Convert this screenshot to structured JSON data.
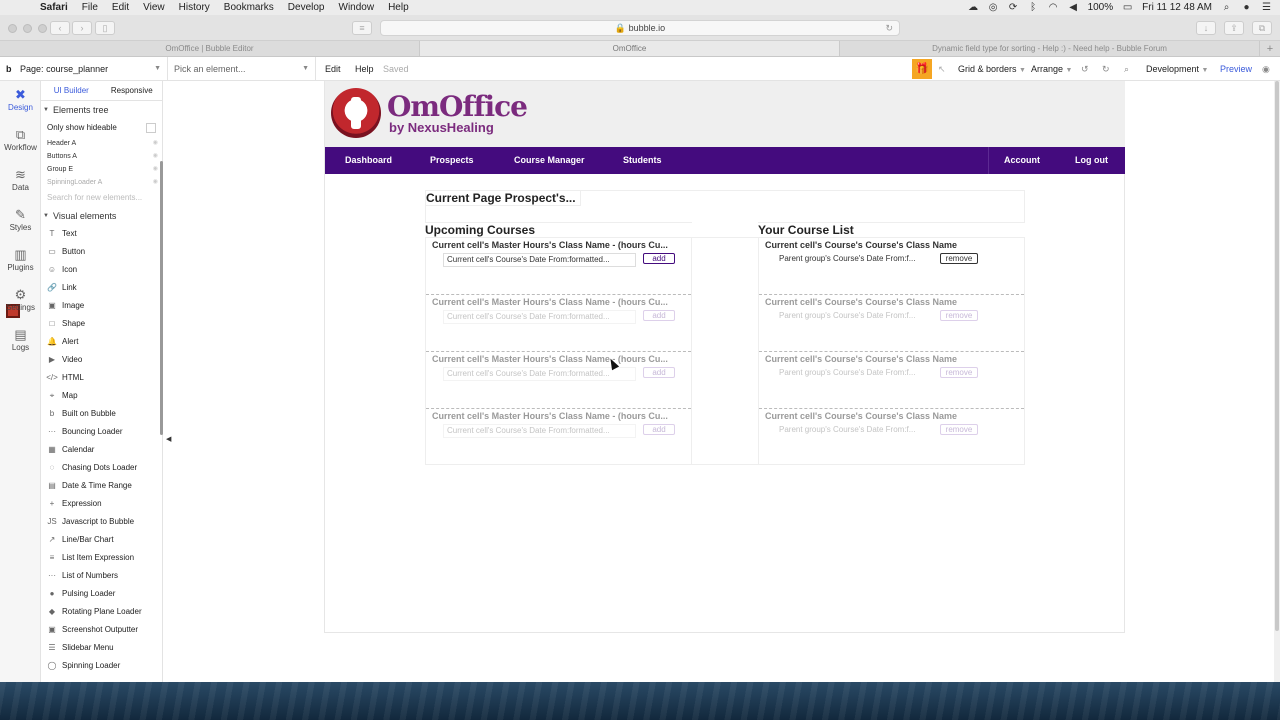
{
  "mac_menubar": {
    "app": "Safari",
    "items": [
      "File",
      "Edit",
      "View",
      "History",
      "Bookmarks",
      "Develop",
      "Window",
      "Help"
    ],
    "battery": "100%",
    "clock": "Fri 11 12 48 AM"
  },
  "browser": {
    "url": "bubble.io",
    "tabs": [
      "OmOffice | Bubble Editor",
      "OmOffice",
      "Dynamic field type for sorting - Help :) - Need help - Bubble Forum"
    ]
  },
  "editor_top": {
    "page_label": "Page:",
    "page_name": "course_planner",
    "element_picker": "Pick an element...",
    "edit": "Edit",
    "help": "Help",
    "saved": "Saved",
    "grid": "Grid & borders",
    "arrange": "Arrange",
    "environment": "Development",
    "preview": "Preview"
  },
  "rail": [
    "Design",
    "Workflow",
    "Data",
    "Styles",
    "Plugins",
    "Settings",
    "Logs"
  ],
  "palette": {
    "tabs": [
      "UI Builder",
      "Responsive"
    ],
    "elements_tree": "Elements tree",
    "only_hideable": "Only show hideable",
    "tree": [
      "Header A",
      "Buttons A",
      "Group E",
      "SpinningLoader A"
    ],
    "search": "Search for new elements...",
    "visual_elements": "Visual elements",
    "items": [
      {
        "icon": "T",
        "label": "Text"
      },
      {
        "icon": "▭",
        "label": "Button"
      },
      {
        "icon": "☺",
        "label": "Icon"
      },
      {
        "icon": "🔗",
        "label": "Link"
      },
      {
        "icon": "▣",
        "label": "Image"
      },
      {
        "icon": "□",
        "label": "Shape"
      },
      {
        "icon": "🔔",
        "label": "Alert"
      },
      {
        "icon": "▶",
        "label": "Video"
      },
      {
        "icon": "</>",
        "label": "HTML"
      },
      {
        "icon": "⌖",
        "label": "Map"
      },
      {
        "icon": "b",
        "label": "Built on Bubble"
      },
      {
        "icon": "···",
        "label": "Bouncing Loader"
      },
      {
        "icon": "▦",
        "label": "Calendar"
      },
      {
        "icon": "◌",
        "label": "Chasing Dots Loader"
      },
      {
        "icon": "▤",
        "label": "Date & Time Range"
      },
      {
        "icon": "+",
        "label": "Expression"
      },
      {
        "icon": "JS",
        "label": "Javascript to Bubble"
      },
      {
        "icon": "↗",
        "label": "Line/Bar Chart"
      },
      {
        "icon": "≡",
        "label": "List Item Expression"
      },
      {
        "icon": "···",
        "label": "List of Numbers"
      },
      {
        "icon": "●",
        "label": "Pulsing Loader"
      },
      {
        "icon": "◆",
        "label": "Rotating Plane Loader"
      },
      {
        "icon": "▣",
        "label": "Screenshot Outputter"
      },
      {
        "icon": "☰",
        "label": "Slidebar Menu"
      },
      {
        "icon": "◯",
        "label": "Spinning Loader"
      }
    ]
  },
  "app": {
    "logo_title": "OmOffice",
    "logo_sub": "by NexusHealing",
    "nav": [
      "Dashboard",
      "Prospects",
      "Course Manager",
      "Students",
      "Account",
      "Log out"
    ],
    "current_prospect": "Current Page Prospect's...",
    "upcoming_title": "Upcoming Courses",
    "your_list_title": "Your  Course List",
    "upcoming_cell_title": "Current cell's Master Hours's Class Name - (hours Cu...",
    "upcoming_cell_date": "Current cell's Course's Date From:formatted...",
    "add": "add",
    "list_cell_title": "Current cell's Course's Course's Class Name",
    "list_cell_date": "Parent group's Course's Date From:f...",
    "remove": "remove"
  }
}
